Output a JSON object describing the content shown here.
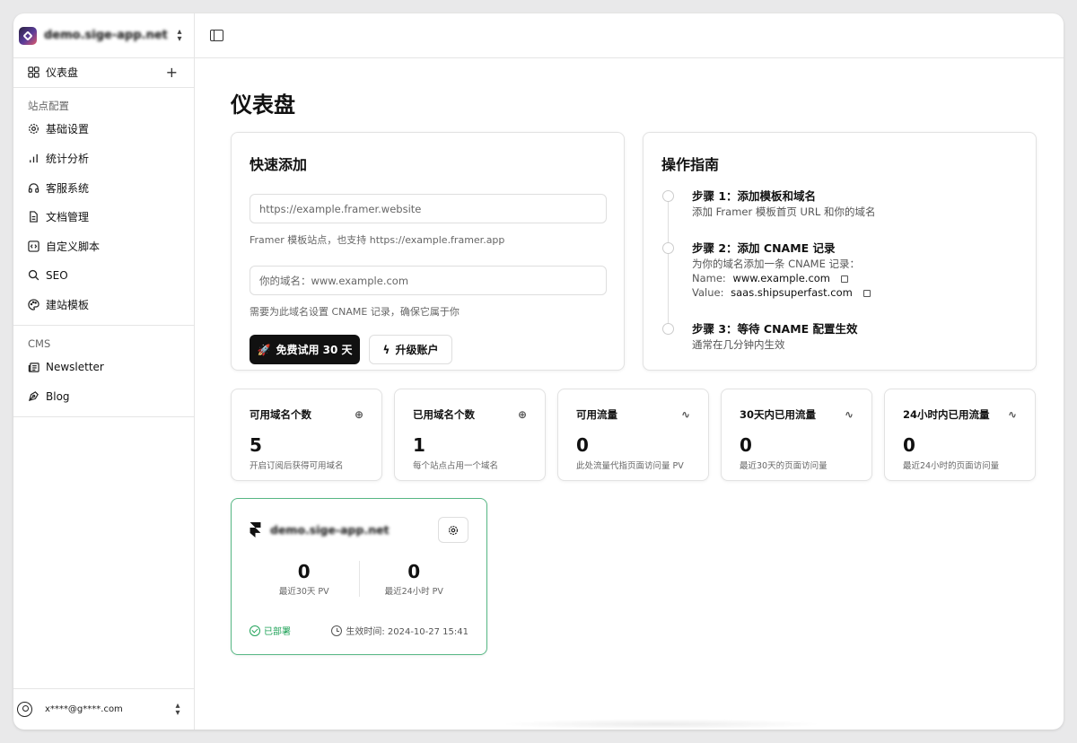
{
  "sidebar": {
    "site_name": "demo.sige-app.net",
    "dashboard_label": "仪表盘",
    "site_config_title": "站点配置",
    "items": [
      {
        "label": "基础设置"
      },
      {
        "label": "统计分析"
      },
      {
        "label": "客服系统"
      },
      {
        "label": "文档管理"
      },
      {
        "label": "自定义脚本"
      },
      {
        "label": "SEO"
      },
      {
        "label": "建站模板"
      }
    ],
    "cms_title": "CMS",
    "cms_items": [
      {
        "label": "Newsletter"
      },
      {
        "label": "Blog"
      }
    ],
    "user_email": "x****@g****.com"
  },
  "main": {
    "title": "仪表盘",
    "quick_add": {
      "title": "快速添加",
      "url_placeholder": "https://example.framer.website",
      "url_hint": "Framer 模板站点，也支持 https://example.framer.app",
      "domain_placeholder": "你的域名：www.example.com",
      "domain_hint": "需要为此域名设置 CNAME 记录，确保它属于你",
      "trial_button": "免费试用 30 天",
      "upgrade_button": "升级账户"
    },
    "guide": {
      "title": "操作指南",
      "step1_title": "步骤 1：添加模板和域名",
      "step1_desc": "添加 Framer 模板首页 URL 和你的域名",
      "step2_title": "步骤 2：添加 CNAME 记录",
      "step2_desc": "为你的域名添加一条 CNAME 记录：",
      "name_label": "Name:",
      "name_value": "www.example.com",
      "value_label": "Value:",
      "value_value": "saas.shipsuperfast.com",
      "step3_title": "步骤 3：等待 CNAME 配置生效",
      "step3_desc": "通常在几分钟内生效"
    },
    "stats": [
      {
        "title": "可用域名个数",
        "value": "5",
        "sub": "开启订阅后获得可用域名",
        "icon": "globe-icon"
      },
      {
        "title": "已用域名个数",
        "value": "1",
        "sub": "每个站点占用一个域名",
        "icon": "globe-icon"
      },
      {
        "title": "可用流量",
        "value": "0",
        "sub": "此处流量代指页面访问量 PV",
        "icon": "activity-icon"
      },
      {
        "title": "30天内已用流量",
        "value": "0",
        "sub": "最近30天的页面访问量",
        "icon": "activity-icon"
      },
      {
        "title": "24小时内已用流量",
        "value": "0",
        "sub": "最近24小时的页面访问量",
        "icon": "activity-icon"
      }
    ],
    "site_card": {
      "name": "demo.sige-app.net",
      "pv30_value": "0",
      "pv30_label": "最近30天 PV",
      "pv24_value": "0",
      "pv24_label": "最近24小时 PV",
      "status": "已部署",
      "time": "生效时间: 2024-10-27 15:41"
    }
  },
  "colors": {
    "accent_green": "#22a35a",
    "card_border_active": "#57b784",
    "primary_button": "#111111"
  }
}
